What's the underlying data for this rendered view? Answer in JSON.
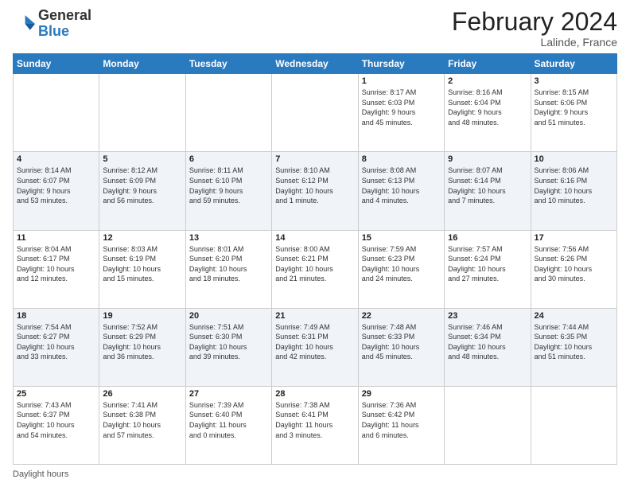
{
  "header": {
    "logo_general": "General",
    "logo_blue": "Blue",
    "main_title": "February 2024",
    "subtitle": "Lalinde, France"
  },
  "footer": {
    "daylight_label": "Daylight hours"
  },
  "weekdays": [
    "Sunday",
    "Monday",
    "Tuesday",
    "Wednesday",
    "Thursday",
    "Friday",
    "Saturday"
  ],
  "weeks": [
    [
      {
        "day": "",
        "detail": ""
      },
      {
        "day": "",
        "detail": ""
      },
      {
        "day": "",
        "detail": ""
      },
      {
        "day": "",
        "detail": ""
      },
      {
        "day": "1",
        "detail": "Sunrise: 8:17 AM\nSunset: 6:03 PM\nDaylight: 9 hours\nand 45 minutes."
      },
      {
        "day": "2",
        "detail": "Sunrise: 8:16 AM\nSunset: 6:04 PM\nDaylight: 9 hours\nand 48 minutes."
      },
      {
        "day": "3",
        "detail": "Sunrise: 8:15 AM\nSunset: 6:06 PM\nDaylight: 9 hours\nand 51 minutes."
      }
    ],
    [
      {
        "day": "4",
        "detail": "Sunrise: 8:14 AM\nSunset: 6:07 PM\nDaylight: 9 hours\nand 53 minutes."
      },
      {
        "day": "5",
        "detail": "Sunrise: 8:12 AM\nSunset: 6:09 PM\nDaylight: 9 hours\nand 56 minutes."
      },
      {
        "day": "6",
        "detail": "Sunrise: 8:11 AM\nSunset: 6:10 PM\nDaylight: 9 hours\nand 59 minutes."
      },
      {
        "day": "7",
        "detail": "Sunrise: 8:10 AM\nSunset: 6:12 PM\nDaylight: 10 hours\nand 1 minute."
      },
      {
        "day": "8",
        "detail": "Sunrise: 8:08 AM\nSunset: 6:13 PM\nDaylight: 10 hours\nand 4 minutes."
      },
      {
        "day": "9",
        "detail": "Sunrise: 8:07 AM\nSunset: 6:14 PM\nDaylight: 10 hours\nand 7 minutes."
      },
      {
        "day": "10",
        "detail": "Sunrise: 8:06 AM\nSunset: 6:16 PM\nDaylight: 10 hours\nand 10 minutes."
      }
    ],
    [
      {
        "day": "11",
        "detail": "Sunrise: 8:04 AM\nSunset: 6:17 PM\nDaylight: 10 hours\nand 12 minutes."
      },
      {
        "day": "12",
        "detail": "Sunrise: 8:03 AM\nSunset: 6:19 PM\nDaylight: 10 hours\nand 15 minutes."
      },
      {
        "day": "13",
        "detail": "Sunrise: 8:01 AM\nSunset: 6:20 PM\nDaylight: 10 hours\nand 18 minutes."
      },
      {
        "day": "14",
        "detail": "Sunrise: 8:00 AM\nSunset: 6:21 PM\nDaylight: 10 hours\nand 21 minutes."
      },
      {
        "day": "15",
        "detail": "Sunrise: 7:59 AM\nSunset: 6:23 PM\nDaylight: 10 hours\nand 24 minutes."
      },
      {
        "day": "16",
        "detail": "Sunrise: 7:57 AM\nSunset: 6:24 PM\nDaylight: 10 hours\nand 27 minutes."
      },
      {
        "day": "17",
        "detail": "Sunrise: 7:56 AM\nSunset: 6:26 PM\nDaylight: 10 hours\nand 30 minutes."
      }
    ],
    [
      {
        "day": "18",
        "detail": "Sunrise: 7:54 AM\nSunset: 6:27 PM\nDaylight: 10 hours\nand 33 minutes."
      },
      {
        "day": "19",
        "detail": "Sunrise: 7:52 AM\nSunset: 6:29 PM\nDaylight: 10 hours\nand 36 minutes."
      },
      {
        "day": "20",
        "detail": "Sunrise: 7:51 AM\nSunset: 6:30 PM\nDaylight: 10 hours\nand 39 minutes."
      },
      {
        "day": "21",
        "detail": "Sunrise: 7:49 AM\nSunset: 6:31 PM\nDaylight: 10 hours\nand 42 minutes."
      },
      {
        "day": "22",
        "detail": "Sunrise: 7:48 AM\nSunset: 6:33 PM\nDaylight: 10 hours\nand 45 minutes."
      },
      {
        "day": "23",
        "detail": "Sunrise: 7:46 AM\nSunset: 6:34 PM\nDaylight: 10 hours\nand 48 minutes."
      },
      {
        "day": "24",
        "detail": "Sunrise: 7:44 AM\nSunset: 6:35 PM\nDaylight: 10 hours\nand 51 minutes."
      }
    ],
    [
      {
        "day": "25",
        "detail": "Sunrise: 7:43 AM\nSunset: 6:37 PM\nDaylight: 10 hours\nand 54 minutes."
      },
      {
        "day": "26",
        "detail": "Sunrise: 7:41 AM\nSunset: 6:38 PM\nDaylight: 10 hours\nand 57 minutes."
      },
      {
        "day": "27",
        "detail": "Sunrise: 7:39 AM\nSunset: 6:40 PM\nDaylight: 11 hours\nand 0 minutes."
      },
      {
        "day": "28",
        "detail": "Sunrise: 7:38 AM\nSunset: 6:41 PM\nDaylight: 11 hours\nand 3 minutes."
      },
      {
        "day": "29",
        "detail": "Sunrise: 7:36 AM\nSunset: 6:42 PM\nDaylight: 11 hours\nand 6 minutes."
      },
      {
        "day": "",
        "detail": ""
      },
      {
        "day": "",
        "detail": ""
      }
    ]
  ]
}
